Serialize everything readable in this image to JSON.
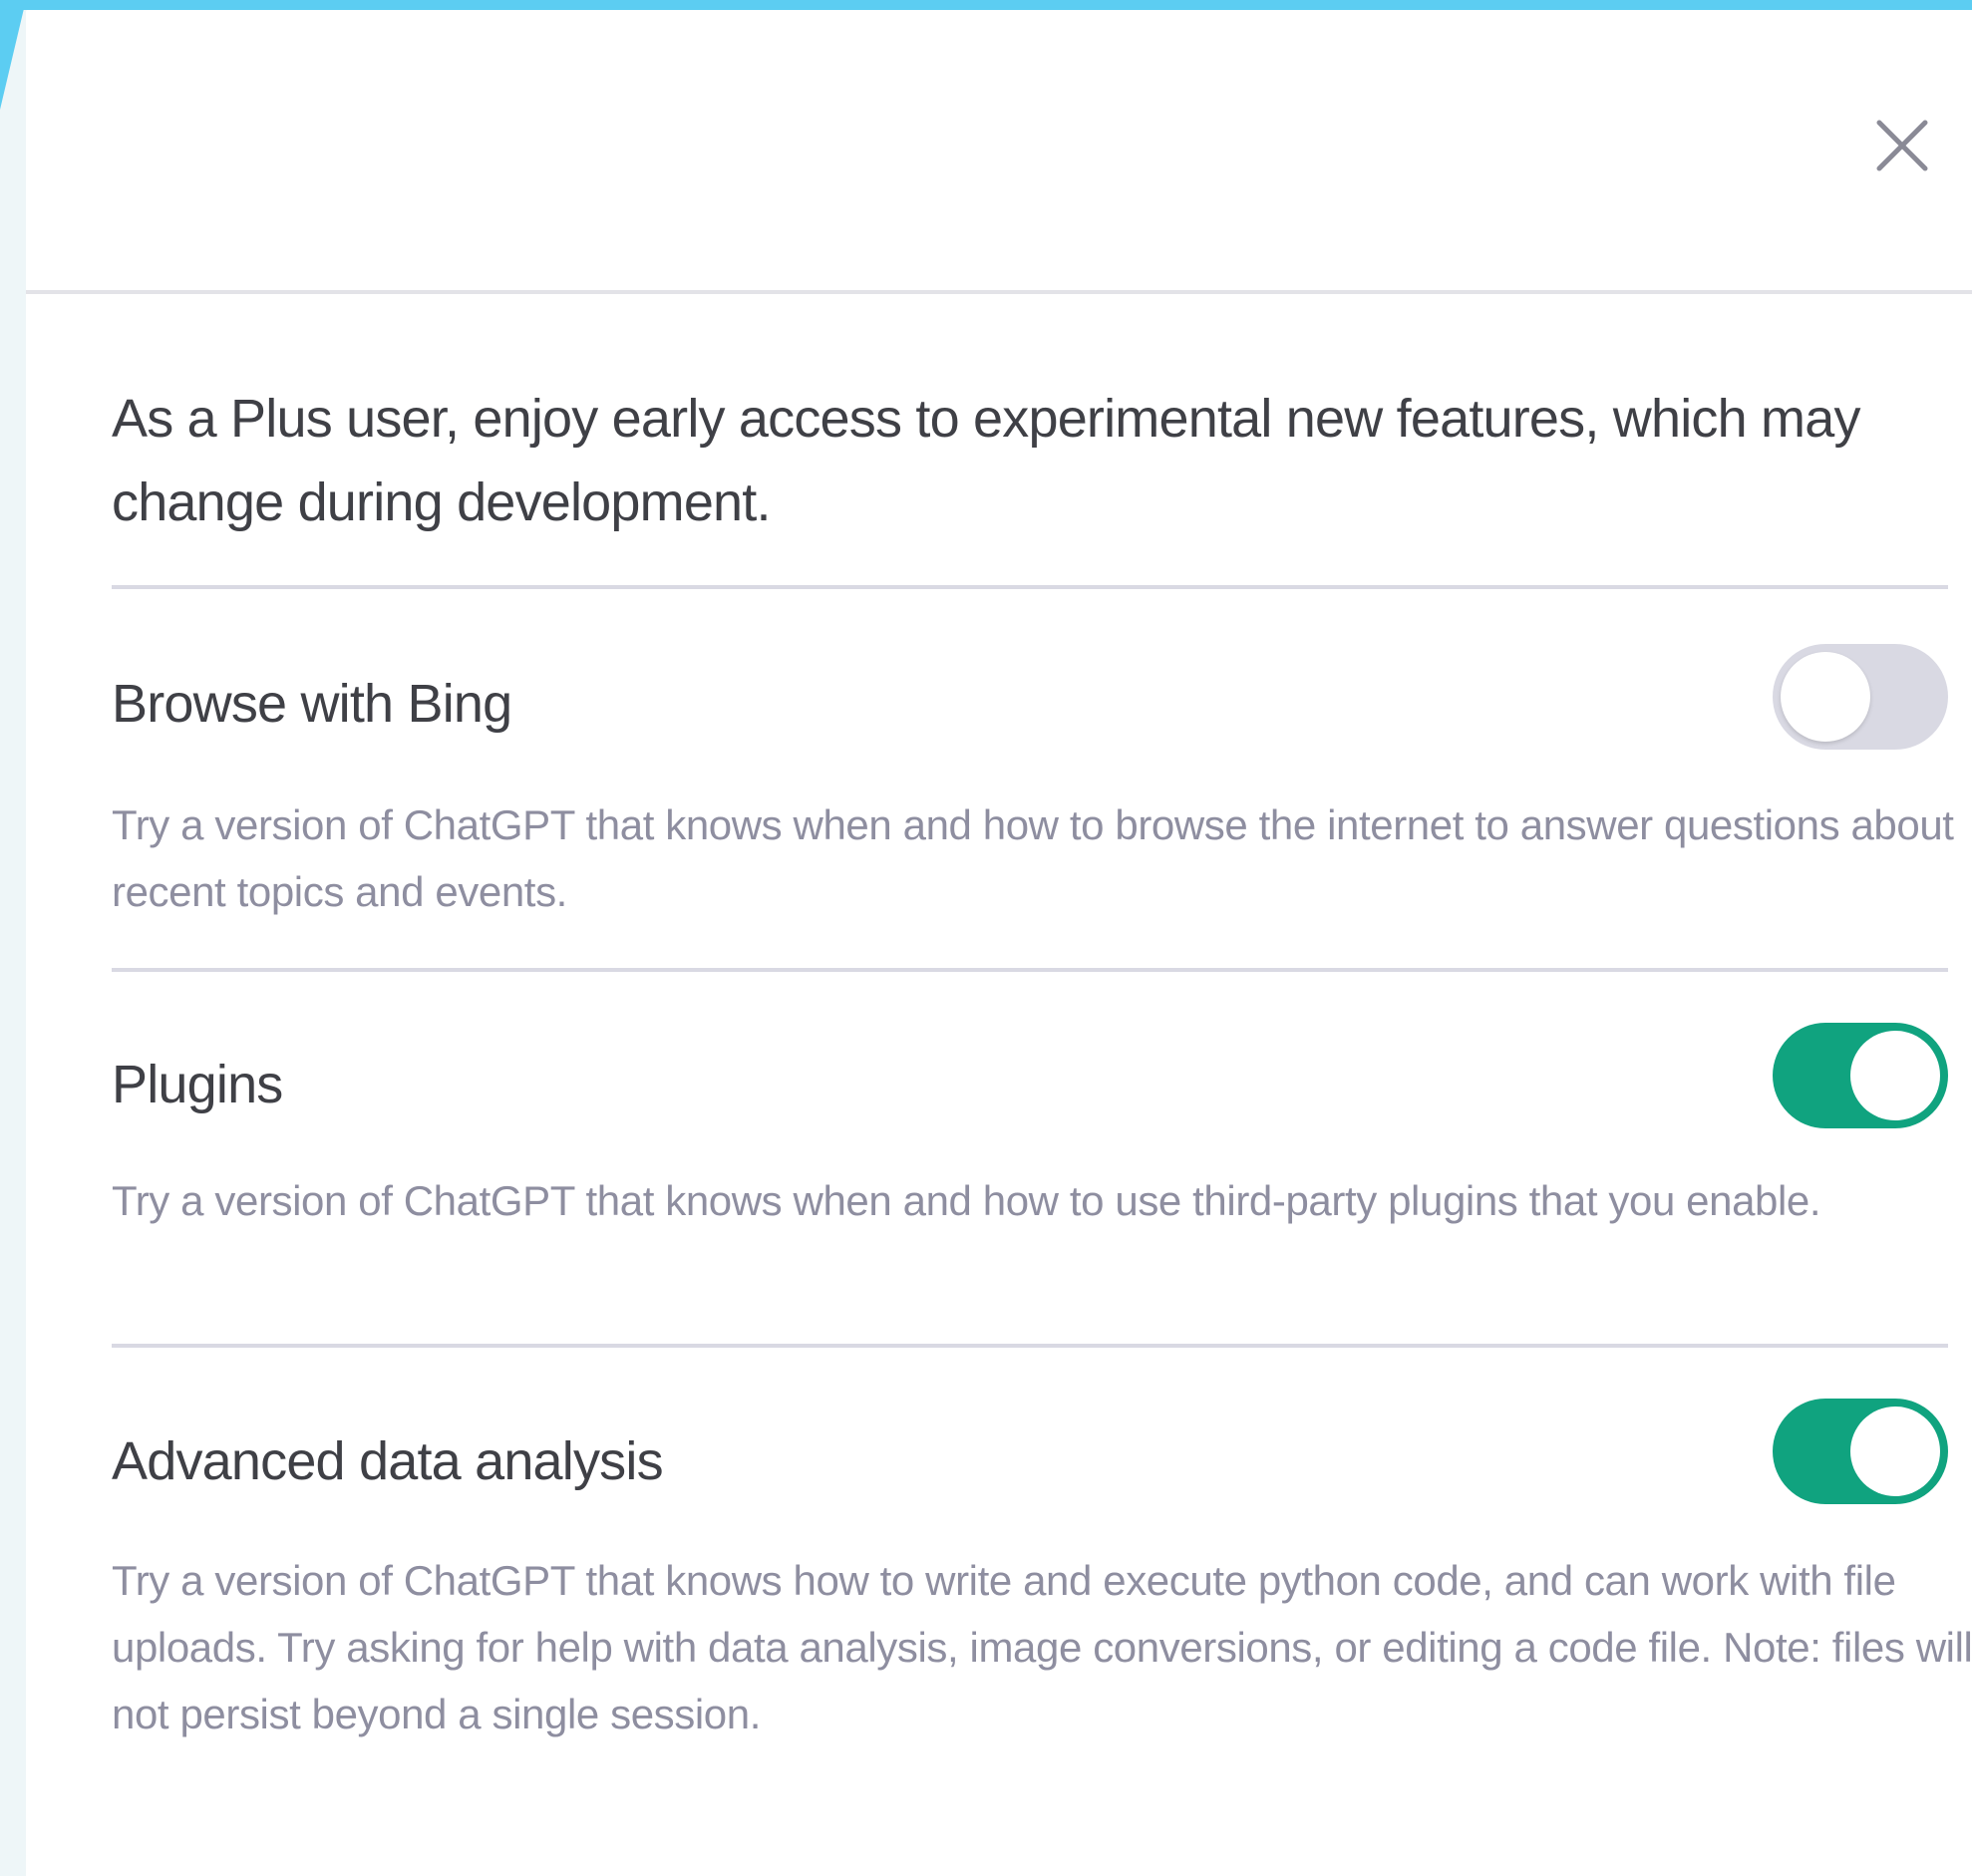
{
  "intro": "As a Plus user, enjoy early access to experimental new features, which may change during development.",
  "close_icon": "close-icon",
  "colors": {
    "toggle_on": "#10a37f",
    "toggle_off": "#d9d9e3",
    "backdrop_accent": "#5ccdf2"
  },
  "features": [
    {
      "title": "Browse with Bing",
      "description": "Try a version of ChatGPT that knows when and how to browse the internet to answer questions about recent topics and events.",
      "enabled": false
    },
    {
      "title": "Plugins",
      "description": "Try a version of ChatGPT that knows when and how to use third-party plugins that you enable.",
      "enabled": true
    },
    {
      "title": "Advanced data analysis",
      "description": "Try a version of ChatGPT that knows how to write and execute python code, and can work with file uploads. Try asking for help with data analysis, image conversions, or editing a code file. Note: files will not persist beyond a single session.",
      "enabled": true
    }
  ]
}
